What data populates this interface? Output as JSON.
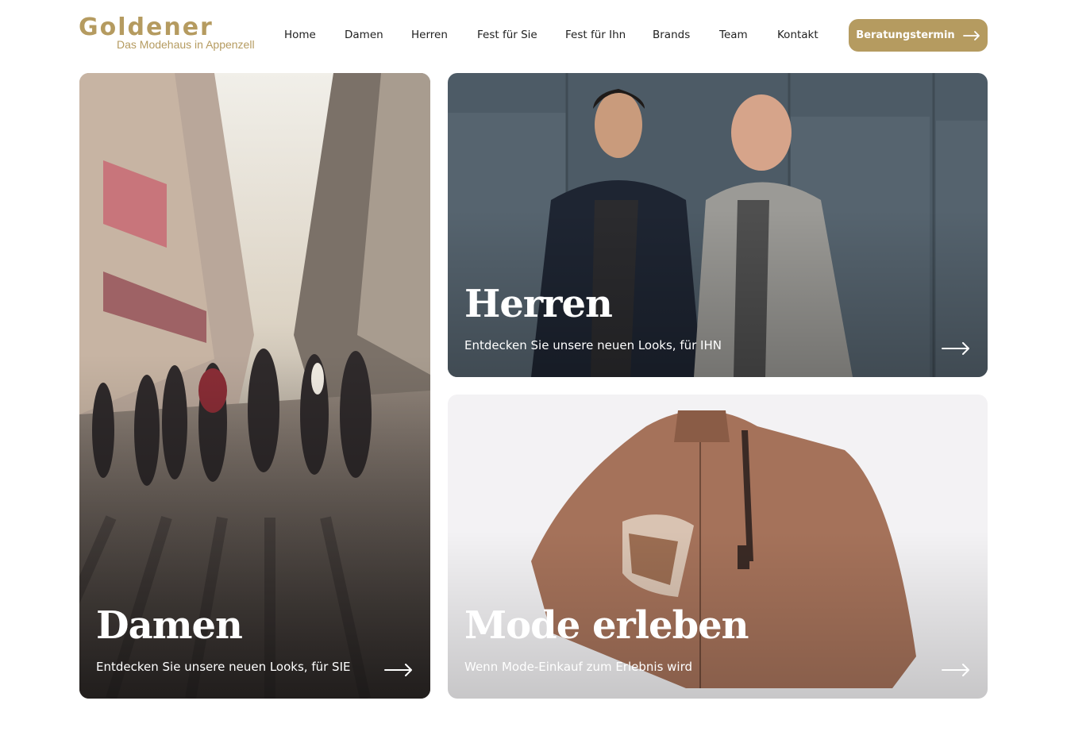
{
  "header": {
    "logo": {
      "word": "Goldener",
      "tagline": "Das Modehaus in Appenzell"
    },
    "nav": [
      "Home",
      "Damen",
      "Herren",
      "Fest für Sie",
      "Fest für Ihn",
      "Brands",
      "Team",
      "Kontakt"
    ],
    "cta_label": "Beratungstermin"
  },
  "cards": {
    "damen": {
      "title": "Damen",
      "subtitle": "Entdecken Sie unsere neuen Looks, für SIE"
    },
    "herren": {
      "title": "Herren",
      "subtitle": "Entdecken Sie unsere neuen Looks, für IHN"
    },
    "mode": {
      "title": "Mode erleben",
      "subtitle": "Wenn Mode-Einkauf zum Erlebnis wird"
    }
  },
  "colors": {
    "accent": "#b59b60",
    "text": "#1f1f1f"
  },
  "icons": {
    "cta": "arrow-right-icon",
    "card": "arrow-right-icon"
  }
}
